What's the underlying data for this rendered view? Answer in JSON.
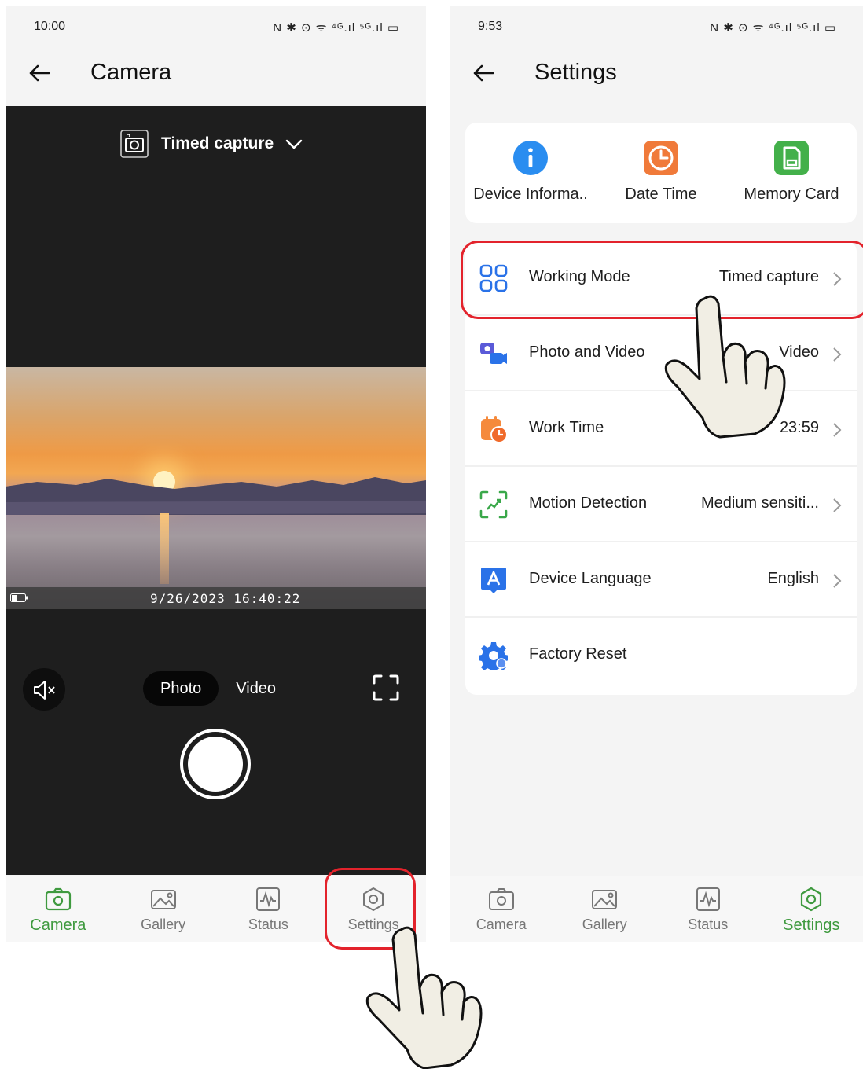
{
  "left_phone": {
    "status": {
      "time": "10:00",
      "icons": "N ✱ ⊙ ᯤ ⁴ᴳ.ıl ⁵ᴳ.ıl ▭"
    },
    "app_bar": {
      "title": "Camera"
    },
    "mode_selector": {
      "label": "Timed capture"
    },
    "preview": {
      "timestamp": "9/26/2023 16:40:22"
    },
    "capture_mode": {
      "options": [
        "Photo",
        "Video"
      ],
      "selected": "Photo"
    },
    "nav": [
      {
        "label": "Camera",
        "icon": "camera-icon",
        "active": true
      },
      {
        "label": "Gallery",
        "icon": "gallery-icon",
        "active": false
      },
      {
        "label": "Status",
        "icon": "status-icon",
        "active": false
      },
      {
        "label": "Settings",
        "icon": "settings-icon",
        "active": false
      }
    ]
  },
  "right_phone": {
    "status": {
      "time": "9:53",
      "icons": "N ✱ ⊙ ᯤ ⁴ᴳ.ıl ⁵ᴳ.ıl ▭"
    },
    "app_bar": {
      "title": "Settings"
    },
    "quick_items": [
      {
        "label": "Device Informa..",
        "icon": "info-icon",
        "color": "#2a8df0"
      },
      {
        "label": "Date Time",
        "icon": "clock-icon",
        "color": "#f07a3a"
      },
      {
        "label": "Memory Card",
        "icon": "sd-card-icon",
        "color": "#43b04a"
      }
    ],
    "settings_rows": [
      {
        "label": "Working Mode",
        "value": "Timed capture",
        "icon": "grid-icon"
      },
      {
        "label": "Photo and Video",
        "value": "Video",
        "icon": "photo-video-icon"
      },
      {
        "label": "Work Time",
        "value": "23:59",
        "icon": "calendar-clock-icon"
      },
      {
        "label": "Motion Detection",
        "value": "Medium sensiti...",
        "icon": "motion-icon"
      },
      {
        "label": "Device Language",
        "value": "English",
        "icon": "language-icon"
      },
      {
        "label": "Factory Reset",
        "value": "",
        "icon": "reset-gear-icon"
      }
    ],
    "nav": [
      {
        "label": "Camera",
        "icon": "camera-icon",
        "active": false
      },
      {
        "label": "Gallery",
        "icon": "gallery-icon",
        "active": false
      },
      {
        "label": "Status",
        "icon": "status-icon",
        "active": false
      },
      {
        "label": "Settings",
        "icon": "settings-icon",
        "active": true
      }
    ]
  },
  "colors": {
    "accent_green": "#3f9a3f",
    "highlight_red": "#e3232c",
    "camera_bg": "#1e1e1e"
  }
}
